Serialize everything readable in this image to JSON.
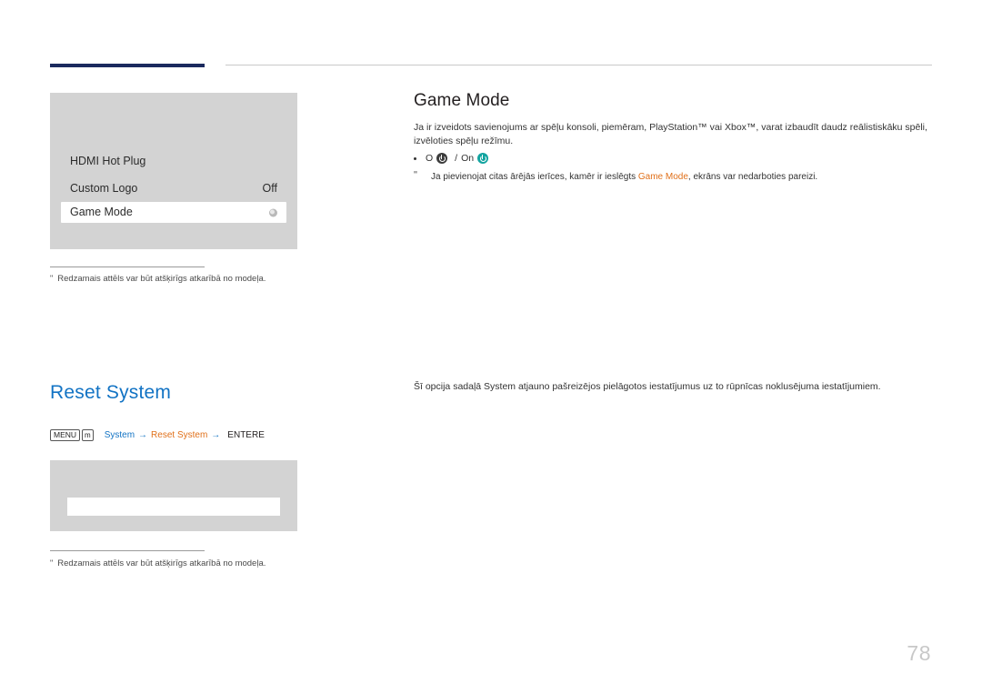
{
  "page": {
    "number": "78"
  },
  "osd_menu": {
    "rows": [
      {
        "label": "HDMI Hot Plug",
        "value": ""
      },
      {
        "label": "Custom Logo",
        "value": "Off"
      },
      {
        "label": "Game Mode",
        "value": "",
        "selected": true
      }
    ]
  },
  "notes": {
    "star": "ʺ",
    "image_note_1": "Redzamais attēls var būt atšķirīgs atkarībā no modeļa.",
    "image_note_2": "Redzamais attēls var būt atšķirīgs atkarībā no modeļa."
  },
  "game_mode": {
    "title": "Game Mode",
    "description": "Ja ir izveidots savienojums ar spēļu konsoli, piemēram, PlayStation™ vai Xbox™, varat izbaudīt daudz reālistiskāku spēli, izvēloties spēļu režīmu.",
    "option_off": "O",
    "option_separator": "/",
    "option_on": "On",
    "caution_marker": "ʺ",
    "caution_prefix": "Ja pievienojat citas ārējās ierīces, kamēr ir ieslēgts ",
    "caution_highlight": "Game Mode",
    "caution_suffix": ", ekrāns var nedarboties pareizi."
  },
  "reset_system": {
    "title": "Reset System",
    "description": "Šī opcija sadaļā System atjauno pašreizējos pielāgotos iestatījumus uz to rūpnīcas noklusējuma iestatījumiem.",
    "path_menu_key": "MENU",
    "path_arrow_key": "m",
    "path_item_1": "System",
    "path_item_2": "Reset System",
    "path_enter": "ENTER",
    "path_enter_symbol": "E"
  },
  "colors": {
    "accent_blue": "#1273c4",
    "accent_orange": "#e0701a",
    "rule_dark": "#1b2a5e",
    "panel_gray": "#d3d3d3",
    "power_on": "#12a4a0"
  }
}
